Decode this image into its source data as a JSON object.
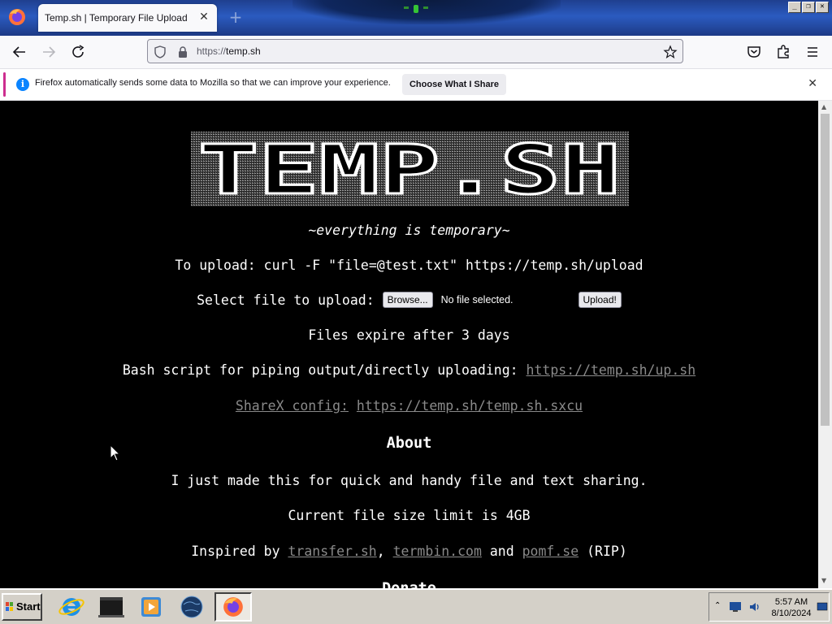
{
  "browser": {
    "tab_title": "Temp.sh | Temporary File Upload",
    "url_protocol": "https://",
    "url_host": "temp.sh",
    "notification": {
      "message": "Firefox automatically sends some data to Mozilla so that we can improve your experience.",
      "button_label": "Choose What I Share"
    }
  },
  "page": {
    "logo_text": "TEMP.SH",
    "tagline": "~everything is temporary~",
    "upload_cmd": "To upload: curl -F \"file=@test.txt\" https://temp.sh/upload",
    "select_label": "Select file to upload:",
    "browse_label": "Browse...",
    "no_file_text": "No file selected.",
    "upload_button": "Upload!",
    "expiry": "Files expire after 3 days",
    "bash_prefix": "Bash script for piping output/directly uploading:",
    "bash_link": "https://temp.sh/up.sh",
    "sharex_label": "ShareX config:",
    "sharex_link": "https://temp.sh/temp.sh.sxcu",
    "about_heading": "About",
    "about_text": "I just made this for quick and handy file and text sharing.",
    "size_limit": "Current file size limit is 4GB",
    "inspired_prefix": "Inspired by",
    "inspired_links": [
      "transfer.sh",
      "termbin.com",
      "pomf.se"
    ],
    "inspired_sep1": ",",
    "inspired_and": "and",
    "inspired_suffix": "(RIP)",
    "donate_heading": "Donate"
  },
  "taskbar": {
    "start_label": "Start",
    "time": "5:57 AM",
    "date": "8/10/2024"
  },
  "colors": {
    "page_bg": "#000000",
    "link": "#8a8a8a",
    "title_bar": "#2b5bc0",
    "firefox_accent": "#cd2d8f"
  },
  "icons": [
    "firefox-icon",
    "back-icon",
    "forward-icon",
    "reload-icon",
    "shield-icon",
    "lock-icon",
    "star-icon",
    "pocket-icon",
    "extensions-icon",
    "menu-icon",
    "info-icon",
    "close-icon",
    "ie-icon",
    "terminal-icon",
    "media-player-icon",
    "globe-icon",
    "firefox-taskbar-icon"
  ]
}
